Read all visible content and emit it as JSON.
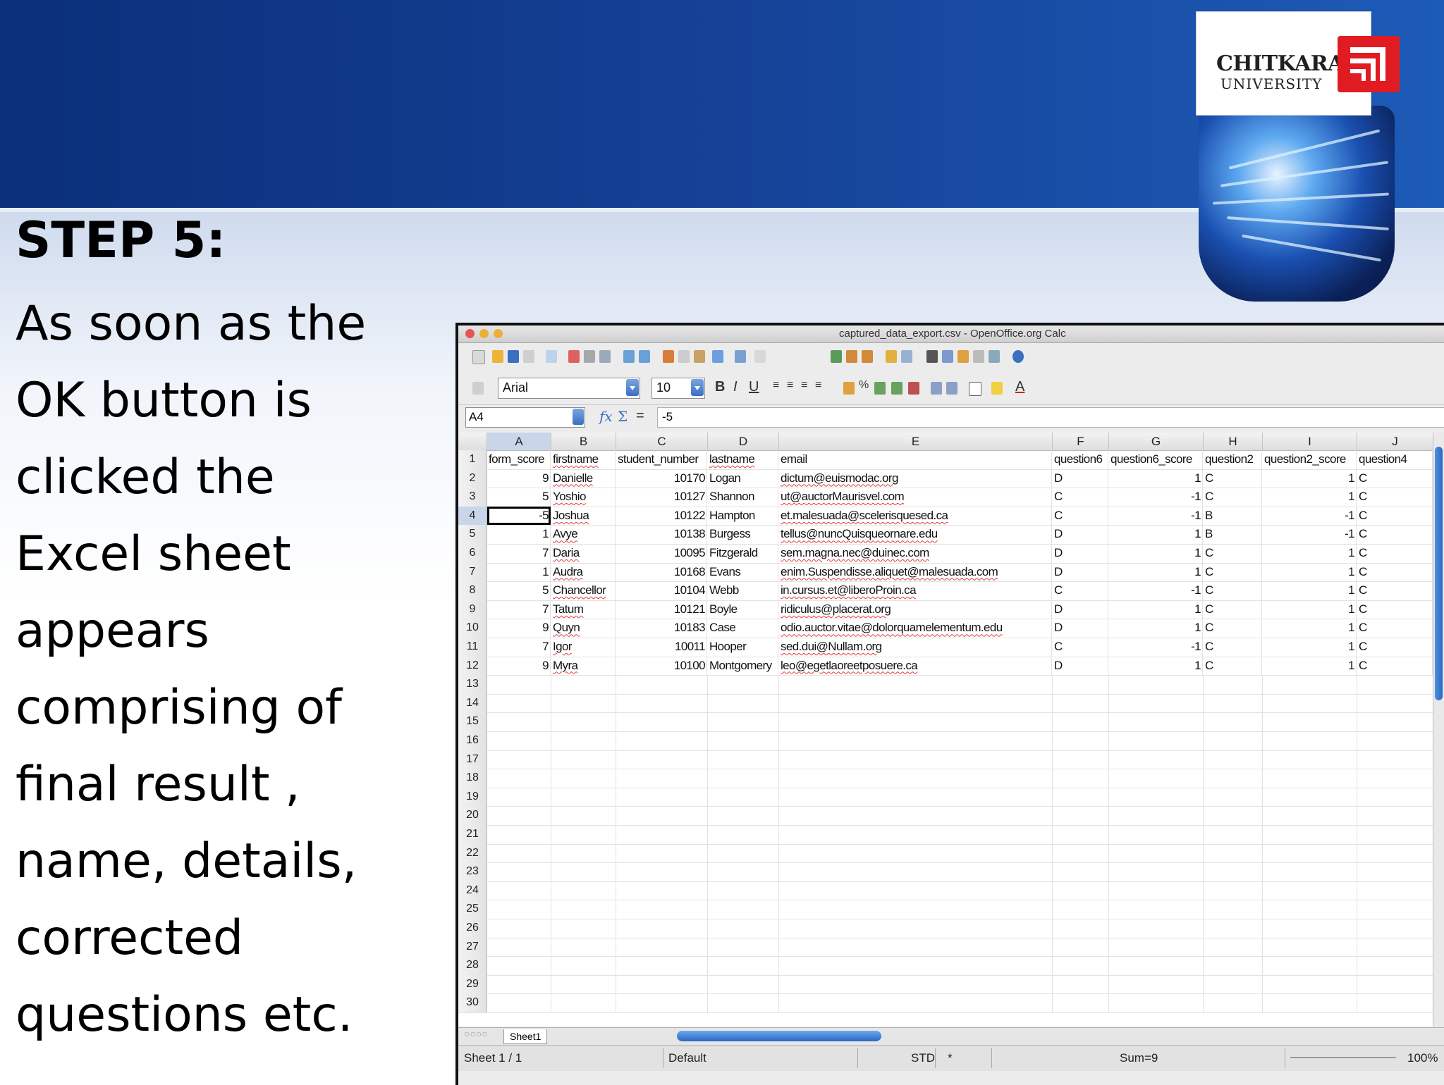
{
  "slide": {
    "step_title": "STEP 5:",
    "step_lines": [
      "As soon as the",
      "OK button is",
      "clicked the",
      "Excel sheet",
      "appears",
      "comprising of",
      "final result ,",
      "name, details,",
      "corrected",
      "questions etc."
    ],
    "logo": {
      "line1": "CHITKARA",
      "line2": "UNIVERSITY",
      "brand_red": "#e11b22"
    }
  },
  "window": {
    "title": "captured_data_export.csv - OpenOffice.org Calc",
    "font_name": "Arial",
    "font_size": "10",
    "cell_ref": "A4",
    "formula_value": "-5",
    "formula_eq": "="
  },
  "sheet": {
    "columns": [
      "A",
      "B",
      "C",
      "D",
      "E",
      "F",
      "G",
      "H",
      "I",
      "J"
    ],
    "selected_column": "A",
    "selected_row": 4,
    "header_row": [
      "form_score",
      "firstname",
      "student_number",
      "lastname",
      "email",
      "question6",
      "question6_score",
      "question2",
      "question2_score",
      "question4"
    ],
    "rows": [
      {
        "score": "9",
        "first": "Danielle",
        "num": "10170",
        "last": "Logan",
        "email": "dictum@euismodac.org",
        "q6": "D",
        "q6s": "1",
        "q2": "C",
        "q2s": "1",
        "q4": "C"
      },
      {
        "score": "5",
        "first": "Yoshio",
        "num": "10127",
        "last": "Shannon",
        "email": "ut@auctorMaurisvel.com",
        "q6": "C",
        "q6s": "-1",
        "q2": "C",
        "q2s": "1",
        "q4": "C"
      },
      {
        "score": "-5",
        "first": "Joshua",
        "num": "10122",
        "last": "Hampton",
        "email": "et.malesuada@scelerisquesed.ca",
        "q6": "C",
        "q6s": "-1",
        "q2": "B",
        "q2s": "-1",
        "q4": "C"
      },
      {
        "score": "1",
        "first": "Avye",
        "num": "10138",
        "last": "Burgess",
        "email": "tellus@nuncQuisqueornare.edu",
        "q6": "D",
        "q6s": "1",
        "q2": "B",
        "q2s": "-1",
        "q4": "C"
      },
      {
        "score": "7",
        "first": "Daria",
        "num": "10095",
        "last": "Fitzgerald",
        "email": "sem.magna.nec@duinec.com",
        "q6": "D",
        "q6s": "1",
        "q2": "C",
        "q2s": "1",
        "q4": "C"
      },
      {
        "score": "1",
        "first": "Audra",
        "num": "10168",
        "last": "Evans",
        "email": "enim.Suspendisse.aliquet@malesuada.com",
        "q6": "D",
        "q6s": "1",
        "q2": "C",
        "q2s": "1",
        "q4": "C"
      },
      {
        "score": "5",
        "first": "Chancellor",
        "num": "10104",
        "last": "Webb",
        "email": "in.cursus.et@liberoProin.ca",
        "q6": "C",
        "q6s": "-1",
        "q2": "C",
        "q2s": "1",
        "q4": "C"
      },
      {
        "score": "7",
        "first": "Tatum",
        "num": "10121",
        "last": "Boyle",
        "email": "ridiculus@placerat.org",
        "q6": "D",
        "q6s": "1",
        "q2": "C",
        "q2s": "1",
        "q4": "C"
      },
      {
        "score": "9",
        "first": "Quyn",
        "num": "10183",
        "last": "Case",
        "email": "odio.auctor.vitae@dolorquamelementum.edu",
        "q6": "D",
        "q6s": "1",
        "q2": "C",
        "q2s": "1",
        "q4": "C"
      },
      {
        "score": "7",
        "first": "Igor",
        "num": "10011",
        "last": "Hooper",
        "email": "sed.dui@Nullam.org",
        "q6": "C",
        "q6s": "-1",
        "q2": "C",
        "q2s": "1",
        "q4": "C"
      },
      {
        "score": "9",
        "first": "Myra",
        "num": "10100",
        "last": "Montgomery",
        "email": "leo@egetlaoreetposuere.ca",
        "q6": "D",
        "q6s": "1",
        "q2": "C",
        "q2s": "1",
        "q4": "C"
      }
    ],
    "row_numbers": [
      "1",
      "2",
      "3",
      "4",
      "5",
      "6",
      "7",
      "8",
      "9",
      "10",
      "11",
      "12",
      "13",
      "14",
      "15",
      "16",
      "17",
      "18",
      "19",
      "20",
      "21",
      "22",
      "23",
      "24",
      "25",
      "26",
      "27",
      "28",
      "29",
      "30"
    ],
    "tab_name": "Sheet1"
  },
  "status": {
    "sheet_pos": "Sheet 1 / 1",
    "page_style": "Default",
    "mode": "STD",
    "mode_extra": "*",
    "sum": "Sum=9",
    "zoom": "100%"
  }
}
